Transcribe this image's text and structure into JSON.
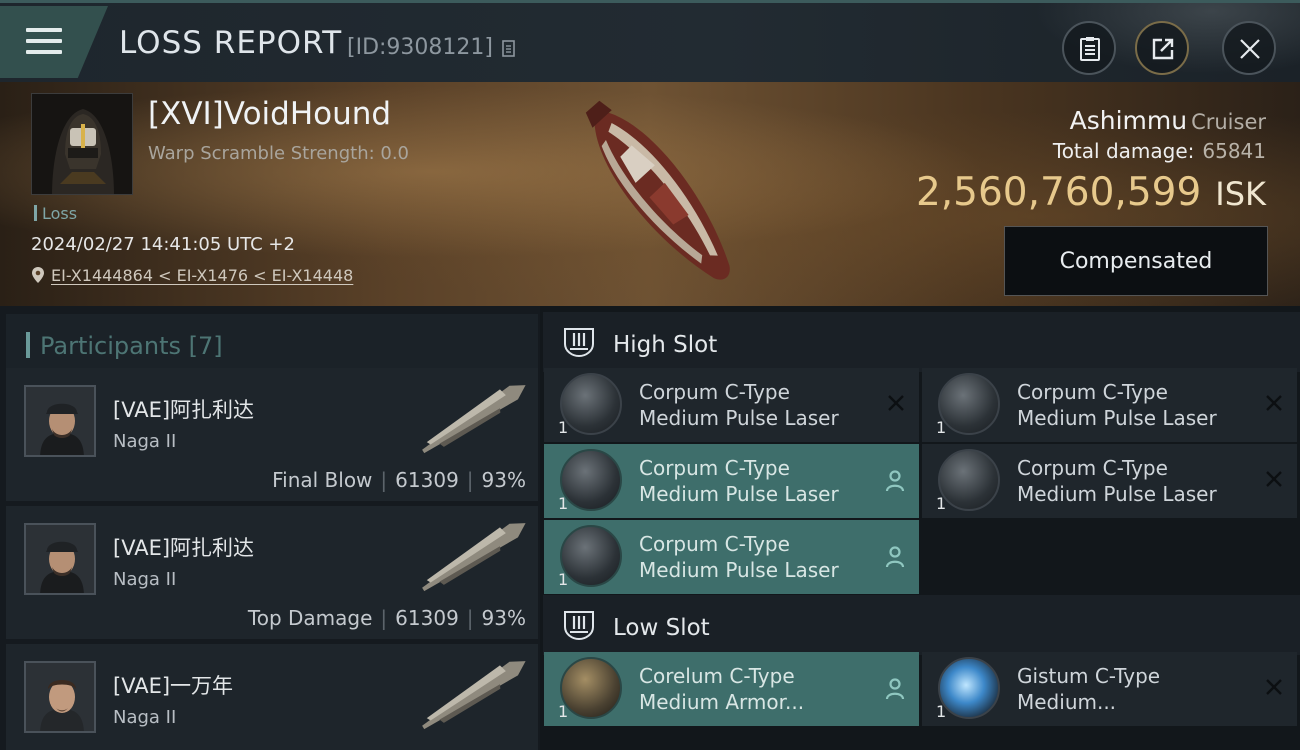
{
  "header": {
    "title": "LOSS REPORT",
    "report_id": "[ID:9308121]",
    "icons": [
      "menu-icon",
      "copy-icon",
      "clipboard-icon",
      "share-icon",
      "close-icon"
    ]
  },
  "victim": {
    "name": "[XVI]VoidHound",
    "warp_scramble": "Warp Scramble Strength: 0.0",
    "tag": "Loss",
    "datetime": "2024/02/27 14:41:05 UTC +2",
    "location": "EI-X1444864 < EI-X1476 < EI-X14448",
    "ship_name": "Ashimmu",
    "ship_class": "Cruiser",
    "total_damage_label": "Total damage:",
    "total_damage": "65841",
    "isk_value": "2,560,760,599",
    "isk_unit": "ISK",
    "compensate_label": "Compensated"
  },
  "participants": {
    "title": "Participants",
    "count": "[7]",
    "list": [
      {
        "name": "[VAE]阿扎利达",
        "ship": "Naga II",
        "role": "Final Blow",
        "damage": "61309",
        "percent": "93%"
      },
      {
        "name": "[VAE]阿扎利达",
        "ship": "Naga II",
        "role": "Top Damage",
        "damage": "61309",
        "percent": "93%"
      },
      {
        "name": "[VAE]一万年",
        "ship": "Naga II",
        "role": "",
        "damage": "",
        "percent": ""
      }
    ]
  },
  "slots": {
    "high": {
      "title": "High Slot",
      "modules": [
        {
          "line1": "Corpum C-Type",
          "line2": "Medium Pulse Laser",
          "qty": "1",
          "status": "destroyed"
        },
        {
          "line1": "Corpum C-Type",
          "line2": "Medium Pulse Laser",
          "qty": "1",
          "status": "destroyed"
        },
        {
          "line1": "Corpum C-Type",
          "line2": "Medium Pulse Laser",
          "qty": "1",
          "status": "dropped"
        },
        {
          "line1": "Corpum C-Type",
          "line2": "Medium Pulse Laser",
          "qty": "1",
          "status": "destroyed"
        },
        {
          "line1": "Corpum C-Type",
          "line2": "Medium Pulse Laser",
          "qty": "1",
          "status": "dropped"
        }
      ]
    },
    "low": {
      "title": "Low Slot",
      "modules": [
        {
          "line1": "Corelum C-Type",
          "line2": "Medium Armor...",
          "qty": "1",
          "status": "dropped"
        },
        {
          "line1": "Gistum C-Type",
          "line2": "Medium...",
          "qty": "1",
          "status": "destroyed"
        }
      ]
    }
  },
  "colors": {
    "accent_teal": "#3e6e6b",
    "isk_gold": "#e7c98c",
    "participants_label": "#4d7574"
  }
}
